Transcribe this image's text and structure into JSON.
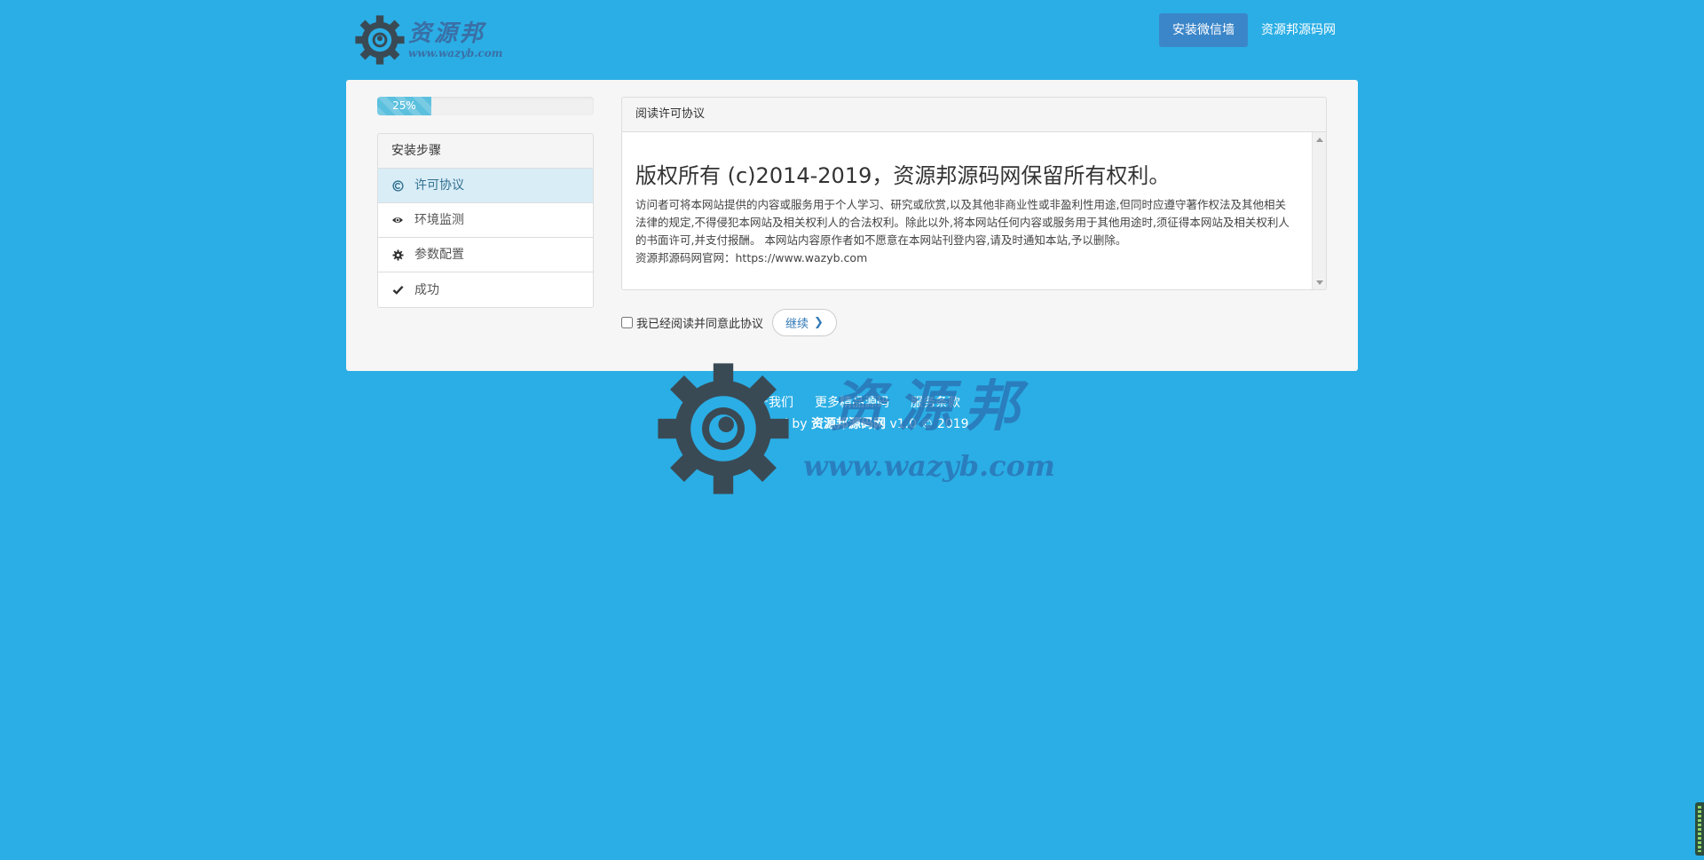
{
  "logo": {
    "name": "资源邦",
    "url": "www.wazyb.com"
  },
  "nav": [
    {
      "label": "安装微信墙",
      "active": true
    },
    {
      "label": "资源邦源码网",
      "active": false
    }
  ],
  "progress": {
    "label": "25%",
    "value": 0.25
  },
  "steps": {
    "title": "安装步骤",
    "items": [
      {
        "label": "许可协议",
        "icon": "copyright-icon",
        "active": true
      },
      {
        "label": "环境监测",
        "icon": "eye-icon",
        "active": false
      },
      {
        "label": "参数配置",
        "icon": "gear-icon",
        "active": false
      },
      {
        "label": "成功",
        "icon": "check-icon",
        "active": false
      }
    ]
  },
  "license": {
    "header": "阅读许可协议",
    "title": "版权所有 (c)2014-2019，资源邦源码网保留所有权利。",
    "body": "访问者可将本网站提供的内容或服务用于个人学习、研究或欣赏,以及其他非商业性或非盈利性用途,但同时应遵守著作权法及其他相关法律的规定,不得侵犯本网站及相关权利人的合法权利。除此以外,将本网站任何内容或服务用于其他用途时,须征得本网站及相关权利人的书面许可,并支付报酬。 本网站内容原作者如不愿意在本网站刊登内容,请及时通知本站,予以删除。",
    "official": "资源邦源码网官网：https://www.wazyb.com"
  },
  "agree": {
    "label": "我已经阅读并同意此协议",
    "checked": false,
    "button": "继续"
  },
  "footer": {
    "links": [
      "关于我们",
      "更多精品源码",
      "服务条款"
    ],
    "copy_prefix": "Powered by ",
    "copy_brand": "资源邦源码网",
    "copy_suffix": " v1.0 © 2019"
  },
  "watermark": {
    "name": "资源邦",
    "url": "www.wazyb.com"
  },
  "colors": {
    "background": "#2aaee5",
    "nav_active": "#3b86c9",
    "progress": "#5bc0de",
    "step_active": "#d9edf7",
    "brand_text": "#3a6fa6"
  }
}
